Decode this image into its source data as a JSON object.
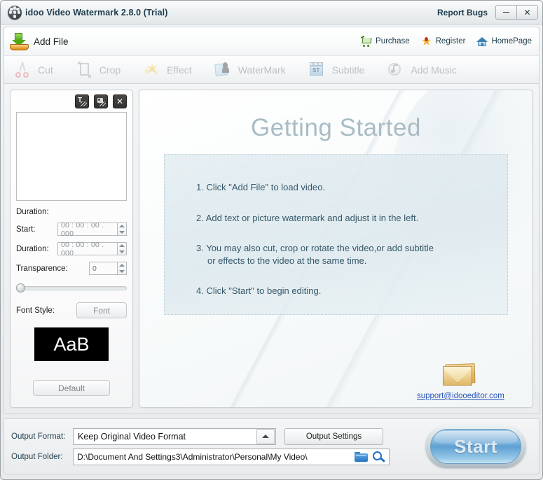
{
  "window": {
    "title": "idoo Video Watermark 2.8.0 (Trial)",
    "app_icon": "film-reel-icon",
    "report_bugs": "Report Bugs",
    "minimize": "—",
    "close": "✕"
  },
  "topbar": {
    "add_file": "Add File",
    "add_file_icon": "download-arrow-icon",
    "links": [
      {
        "label": "Purchase",
        "icon": "shopping-cart-icon"
      },
      {
        "label": "Register",
        "icon": "star-icon"
      },
      {
        "label": "HomePage",
        "icon": "home-icon"
      }
    ]
  },
  "tools": [
    {
      "label": "Cut",
      "icon": "scissors-icon",
      "enabled": false
    },
    {
      "label": "Crop",
      "icon": "crop-icon",
      "enabled": false
    },
    {
      "label": "Effect",
      "icon": "stars-icon",
      "enabled": false
    },
    {
      "label": "WaterMark",
      "icon": "watermark-icon",
      "enabled": false
    },
    {
      "label": "Subtitle",
      "icon": "clapperboard-st-icon",
      "enabled": false
    },
    {
      "label": "Add Music",
      "icon": "music-disc-icon",
      "enabled": false
    }
  ],
  "subtitle_icon_text": "ST",
  "left_panel": {
    "watermark_buttons": [
      {
        "name": "add-text-watermark",
        "icon": "text-watermark-icon"
      },
      {
        "name": "add-picture-watermark",
        "icon": "picture-watermark-icon"
      },
      {
        "name": "delete-watermark",
        "icon": "close-icon",
        "glyph": "✕"
      }
    ],
    "duration_title": "Duration:",
    "start_label": "Start:",
    "start_value": "00 : 00 : 00 . 000",
    "duration_label": "Duration:",
    "duration_value": "00 : 00 : 00 . 000",
    "transparence_label": "Transparence:",
    "transparence_value": "0",
    "slider_position_percent": 0,
    "font_style_label": "Font Style:",
    "font_button": "Font",
    "font_preview_text": "AaB",
    "font_preview_bg": "#000000",
    "font_preview_fg": "#ffffff",
    "default_button": "Default"
  },
  "getting_started": {
    "title": "Getting Started",
    "steps": [
      {
        "line1": "1. Click \"Add File\" to load video.",
        "line2": ""
      },
      {
        "line1": "2. Add text or picture watermark and adjust it in the left.",
        "line2": ""
      },
      {
        "line1": "3. You may also cut, crop or rotate the video,or add subtitle",
        "line2": "or effects to the video at the same time."
      },
      {
        "line1": "4. Click \"Start\" to begin editing.",
        "line2": ""
      }
    ],
    "support_email": "support@idooeditor.com",
    "support_icon": "envelope-icon"
  },
  "footer": {
    "output_format_label": "Output Format:",
    "output_format_value": "Keep Original Video Format",
    "output_format_arrow_icon": "chevron-up-icon",
    "output_settings_button": "Output Settings",
    "output_folder_label": "Output Folder:",
    "output_folder_value": "D:\\Document And Settings3\\Administrator\\Personal\\My Video\\",
    "folder_icon": "folder-icon",
    "search_icon": "magnifier-icon",
    "start_button": "Start"
  },
  "colors": {
    "title_text": "#1d3c4d",
    "link_blue": "#2b56b8",
    "gs_title": "#a9bcc4",
    "gs_text": "#36586a",
    "start_blue": "#7fb4dd"
  }
}
